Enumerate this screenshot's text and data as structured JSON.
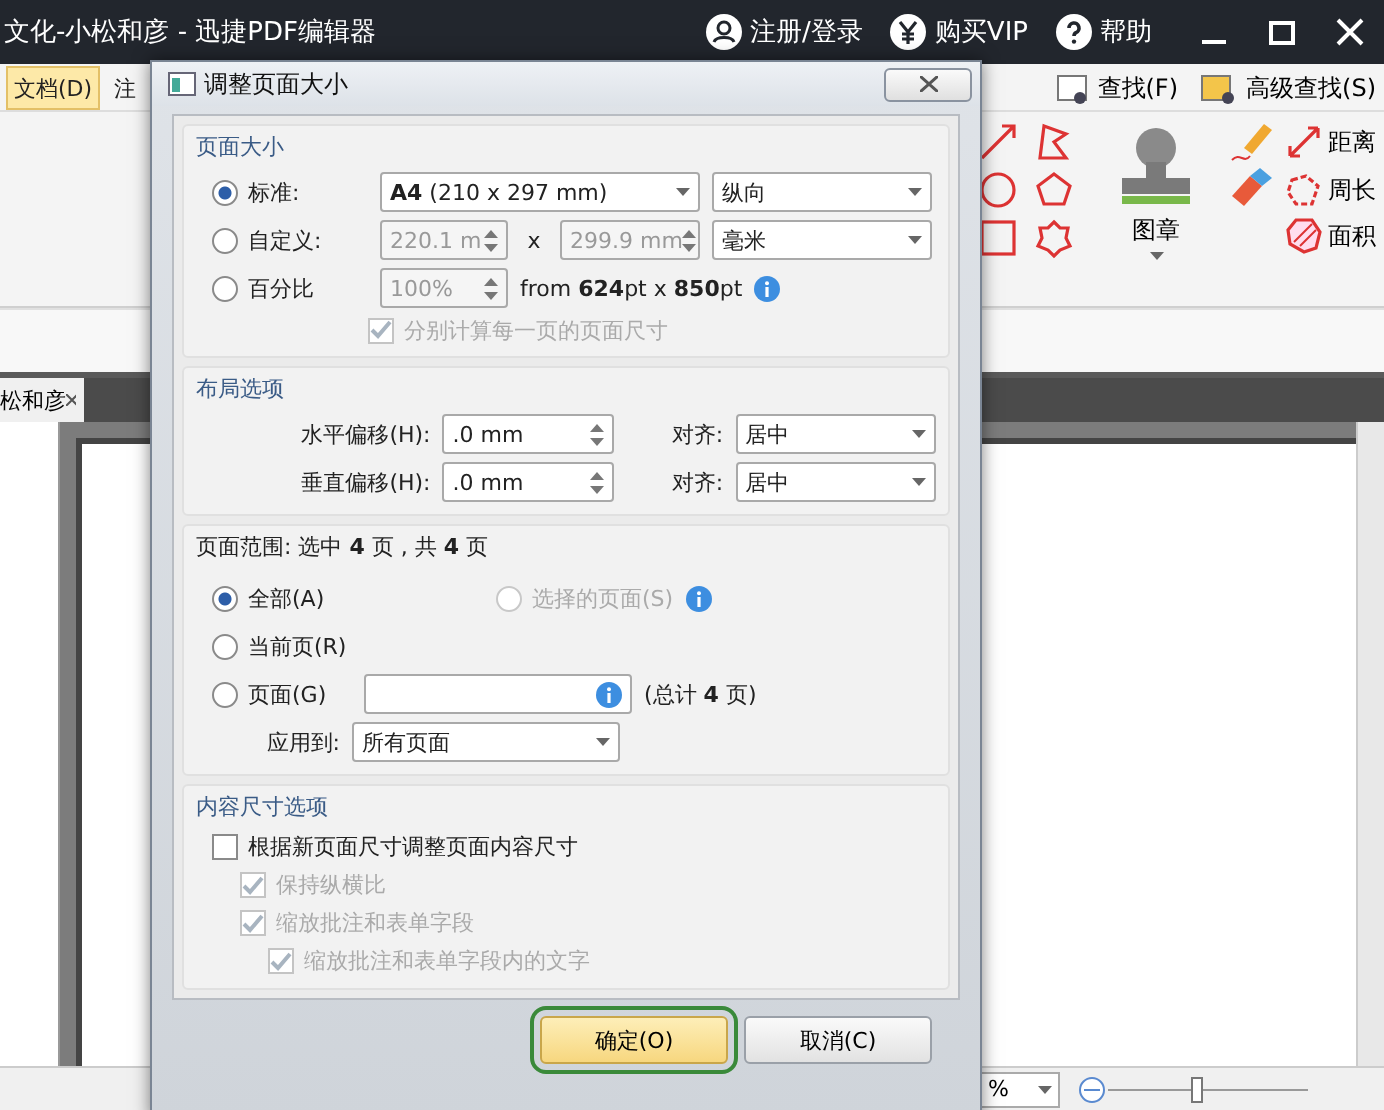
{
  "app": {
    "title": "文化-小松和彦 - 迅捷PDF编辑器",
    "account_links": [
      {
        "kind": "user",
        "label": "注册/登录"
      },
      {
        "kind": "vip",
        "label": "购买VIP"
      },
      {
        "kind": "help",
        "label": "帮助"
      }
    ],
    "ribbon_tabs": [
      {
        "label": "文档(D)",
        "selected": true
      },
      {
        "label": "注",
        "selected": false
      }
    ],
    "search_buttons": [
      "查找(F)",
      "高级查找(S)"
    ],
    "stamp_label": "图章",
    "measure_tools": [
      "距离",
      "周长",
      "面积"
    ],
    "doc_tab": "松和彦",
    "zoom_value": "%"
  },
  "dialog": {
    "title": "调整页面大小",
    "page_size": {
      "title": "页面大小",
      "options": [
        {
          "label": "标准:",
          "selected": true
        },
        {
          "label": "自定义:",
          "selected": false
        },
        {
          "label": "百分比",
          "selected": false
        }
      ],
      "standard_size": "**A4** (210 x 297 mm)",
      "orientation": "纵向",
      "width": "220.1 m",
      "times": "x",
      "height": "299.9 mm",
      "unit": "毫米",
      "percent": "100%",
      "source_size": "from **624**pt x **850**pt",
      "per_page": {
        "label": "分别计算每一页的页面尺寸",
        "checked": true,
        "disabled": true
      }
    },
    "layout": {
      "title": "布局选项",
      "rows": [
        {
          "label": "水平偏移(H):",
          "value": ".0 mm",
          "align_label": "对齐:",
          "align": "居中"
        },
        {
          "label": "垂直偏移(H):",
          "value": ".0 mm",
          "align_label": "对齐:",
          "align": "居中"
        }
      ]
    },
    "page_range": {
      "title": "页面范围: 选中 **4** 页 , 共 **4** 页",
      "options": [
        {
          "kind": "all",
          "label": "全部(A)",
          "selected": true,
          "disabled": false
        },
        {
          "kind": "selection",
          "label": "选择的页面(S)",
          "selected": false,
          "disabled": true
        },
        {
          "kind": "current",
          "label": "当前页(R)",
          "selected": false,
          "disabled": false
        },
        {
          "kind": "pages",
          "label": "页面(G)",
          "selected": false,
          "disabled": false
        }
      ],
      "total": "(总计 **4** 页)",
      "apply_label": "应用到:",
      "apply_to": "所有页面"
    },
    "content": {
      "title": "内容尺寸选项",
      "options": [
        {
          "label": "根据新页面尺寸调整页面内容尺寸",
          "checked": false,
          "disabled": false,
          "children": [
            {
              "label": "保持纵横比",
              "checked": true,
              "disabled": true
            },
            {
              "label": "缩放批注和表单字段",
              "checked": true,
              "disabled": true,
              "children": [
                {
                  "label": "缩放批注和表单字段内的文字",
                  "checked": true,
                  "disabled": true
                }
              ]
            }
          ]
        }
      ]
    },
    "buttons": [
      {
        "label": "确定(O)",
        "default": true
      },
      {
        "label": "取消(C)",
        "default": false
      }
    ]
  }
}
